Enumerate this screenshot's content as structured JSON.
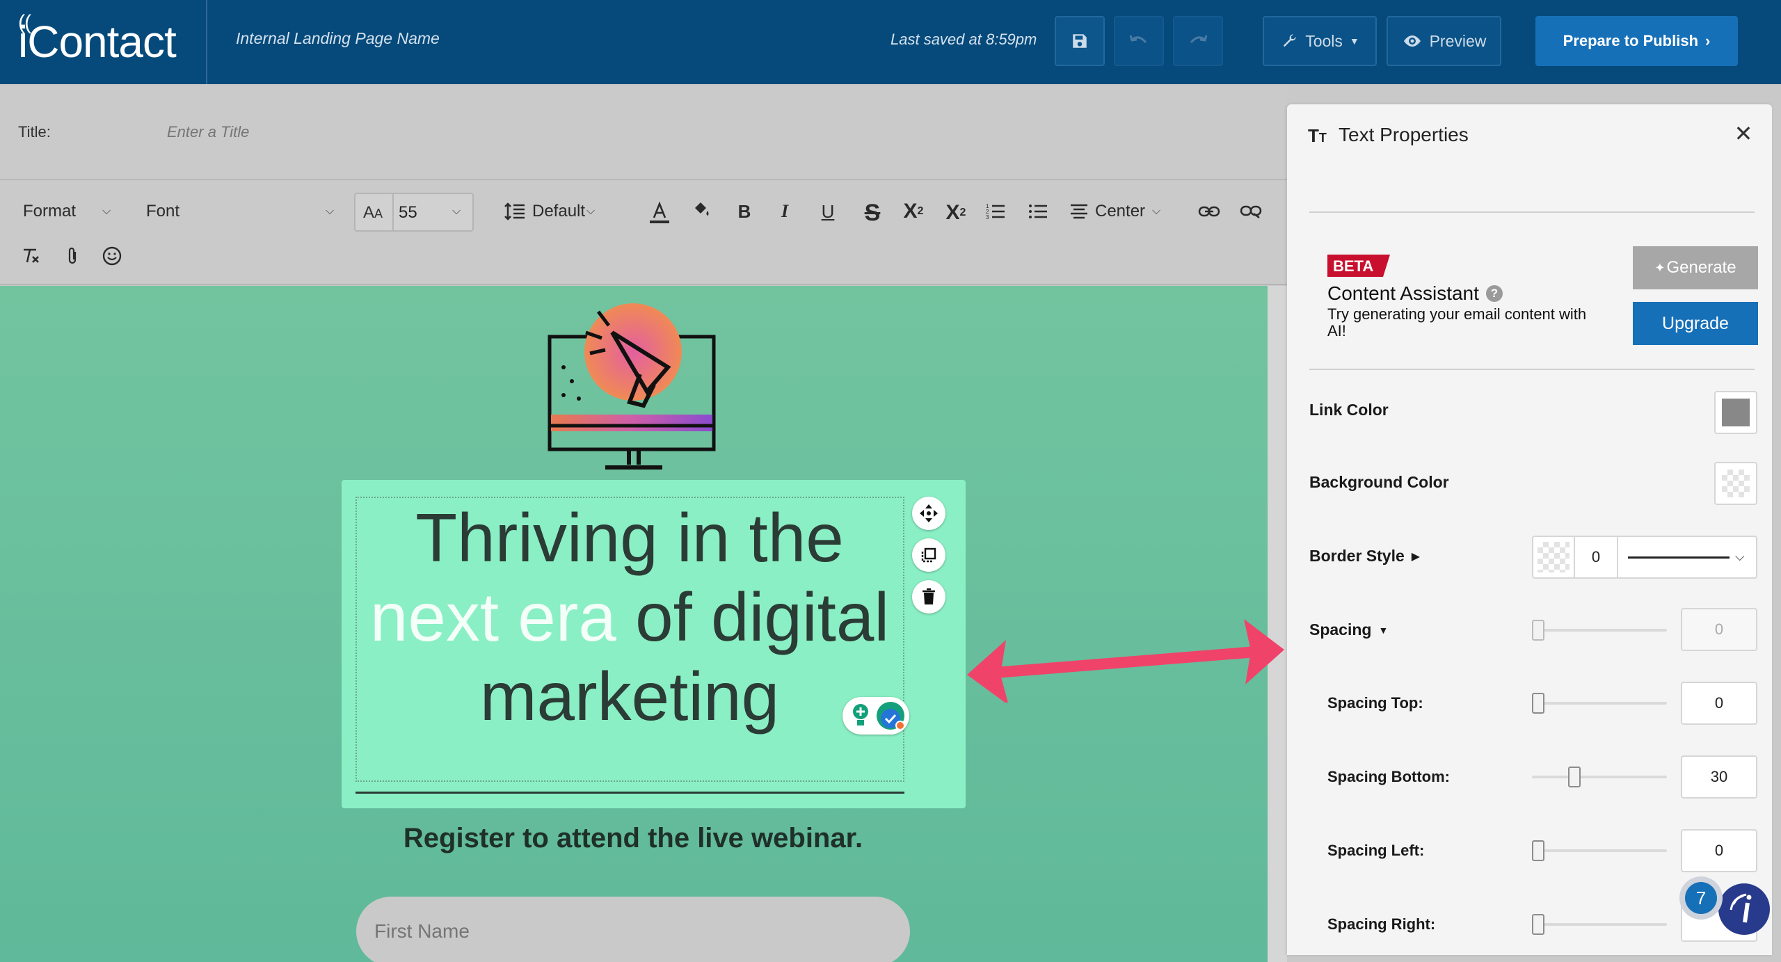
{
  "header": {
    "logo": "iContact",
    "page_name": "Internal Landing Page Name",
    "last_saved": "Last saved at 8:59pm",
    "tools_label": "Tools",
    "preview_label": "Preview",
    "publish_label": "Prepare to Publish",
    "colors": {
      "bar": "#064a7b",
      "publish": "#1670b8"
    }
  },
  "title_bar": {
    "label": "Title:",
    "placeholder": "Enter a Title"
  },
  "toolbar": {
    "format_label": "Format",
    "font_label": "Font",
    "font_size": "55",
    "line_height": "Default",
    "align": "Center",
    "icons": [
      "text-size-icon",
      "line-height-icon",
      "text-color-icon",
      "highlight-icon",
      "bold-icon",
      "italic-icon",
      "underline-icon",
      "strikethrough-icon",
      "superscript-icon",
      "subscript-icon",
      "ordered-list-icon",
      "bullet-list-icon",
      "align-center-icon",
      "link-icon",
      "unlink-icon",
      "clear-format-icon",
      "attachment-icon",
      "emoji-icon"
    ]
  },
  "canvas": {
    "headline_before": "Thriving in the",
    "headline_highlight": "next era",
    "headline_after": "of digital marketing",
    "subtitle": "Register to attend the live webinar.",
    "first_name_placeholder": "First Name",
    "colors": {
      "background": "#6ec19f",
      "block": "#8aefc4",
      "arrow": "#f0436a"
    }
  },
  "panel": {
    "title": "Text Properties",
    "beta_label": "BETA",
    "assistant_title": "Content Assistant",
    "assistant_desc": "Try generating your email content with AI!",
    "generate_label": "Generate",
    "upgrade_label": "Upgrade",
    "link_color_label": "Link Color",
    "link_color": "#888888",
    "background_color_label": "Background Color",
    "border_style_label": "Border Style",
    "border_width": "0",
    "spacing_label": "Spacing",
    "spacing_value": "0",
    "spacing_top_label": "Spacing Top:",
    "spacing_top": "0",
    "spacing_bottom_label": "Spacing Bottom:",
    "spacing_bottom": "30",
    "spacing_left_label": "Spacing Left:",
    "spacing_left": "0",
    "spacing_right_label": "Spacing Right:"
  },
  "chat": {
    "badge_count": "7"
  }
}
